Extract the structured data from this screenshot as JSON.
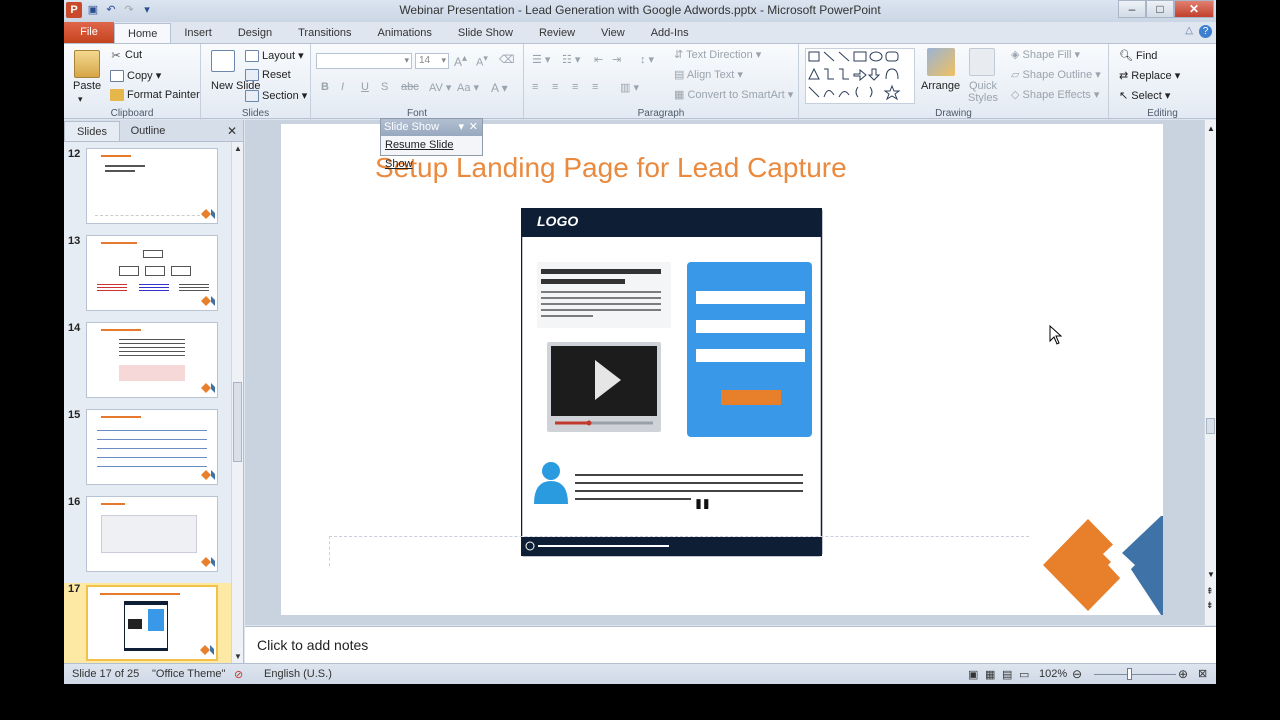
{
  "window": {
    "title": "Webinar Presentation - Lead Generation with Google Adwords.pptx - Microsoft PowerPoint",
    "minimize": "–",
    "maximize": "□",
    "close": "✕"
  },
  "tabs": [
    "File",
    "Home",
    "Insert",
    "Design",
    "Transitions",
    "Animations",
    "Slide Show",
    "Review",
    "View",
    "Add-Ins"
  ],
  "ribbon": {
    "clipboard": {
      "label": "Clipboard",
      "paste": "Paste",
      "cut": "Cut",
      "copy": "Copy",
      "format_painter": "Format Painter"
    },
    "slides": {
      "label": "Slides",
      "new_slide": "New Slide",
      "layout": "Layout",
      "reset": "Reset",
      "section": "Section"
    },
    "font": {
      "label": "Font",
      "font_size": "14"
    },
    "paragraph": {
      "label": "Paragraph",
      "text_direction": "Text Direction",
      "align_text": "Align Text",
      "convert_smartart": "Convert to SmartArt"
    },
    "drawing": {
      "label": "Drawing",
      "arrange": "Arrange",
      "quick_styles": "Quick Styles",
      "shape_fill": "Shape Fill",
      "shape_outline": "Shape Outline",
      "shape_effects": "Shape Effects"
    },
    "editing": {
      "label": "Editing",
      "find": "Find",
      "replace": "Replace",
      "select": "Select"
    }
  },
  "left_pane": {
    "tabs": [
      "Slides",
      "Outline"
    ],
    "close": "✕",
    "thumbnails": [
      {
        "num": "12"
      },
      {
        "num": "13"
      },
      {
        "num": "14"
      },
      {
        "num": "15"
      },
      {
        "num": "16"
      },
      {
        "num": "17",
        "selected": true
      }
    ]
  },
  "slideshow_toolbar": {
    "title": "Slide Show",
    "resume": "Resume Slide Show"
  },
  "slide": {
    "title": "Setup Landing Page for Lead Capture",
    "logo": "LOGO",
    "colors": {
      "accent_orange": "#e8802b",
      "accent_blue": "#3a98e8",
      "navy": "#0e1f35"
    }
  },
  "notes": {
    "placeholder": "Click to add notes"
  },
  "status": {
    "slide_info": "Slide 17 of 25",
    "theme": "\"Office Theme\"",
    "language": "English (U.S.)",
    "zoom": "102%"
  }
}
